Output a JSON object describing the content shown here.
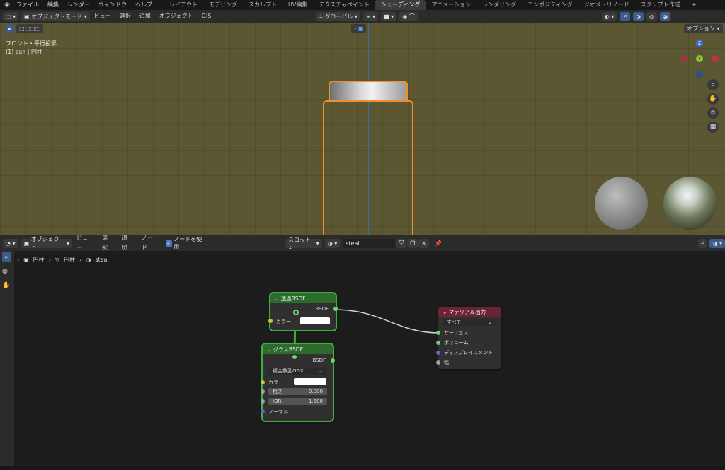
{
  "topbar": {
    "menus": [
      "ファイル",
      "編集",
      "レンダー",
      "ウィンドウ",
      "ヘルプ"
    ],
    "tabs": [
      "レイアウト",
      "モデリング",
      "スカルプト",
      "UV編集",
      "テクスチャペイント",
      "シェーディング",
      "アニメーション",
      "レンダリング",
      "コンポジティング",
      "ジオメトリノード",
      "スクリプト作成",
      "+"
    ]
  },
  "viewport": {
    "mode": "オブジェクトモード",
    "menus": [
      "ビュー",
      "選択",
      "追加",
      "オブジェクト",
      "GIS"
    ],
    "orientation": "グローバル",
    "options": "オプション",
    "view_label": "フロント・平行投影",
    "object_label": "(1) can | 円柱",
    "gizmo": {
      "z": "Z",
      "y": "Y"
    }
  },
  "node_header": {
    "mode": "オブジェクト",
    "menus": [
      "ビュー",
      "選択",
      "追加",
      "ノード"
    ],
    "use_nodes": "ノードを使用",
    "slot": "スロット1",
    "material": "steal"
  },
  "breadcrumb": {
    "obj": "円柱",
    "mesh": "円柱",
    "mat": "steal"
  },
  "nodes": {
    "transparent": {
      "title": "透過BSDF",
      "out": "BSDF",
      "color": "カラー"
    },
    "glass": {
      "title": "グラスBSDF",
      "out": "BSDF",
      "dist": "複合散乱GGX",
      "color": "カラー",
      "rough_label": "粗さ",
      "rough": "0.000",
      "ior_label": "IOR",
      "ior": "1.500",
      "normal": "ノーマル"
    },
    "output": {
      "title": "マテリアル出力",
      "target": "すべて",
      "surface": "サーフェス",
      "volume": "ボリューム",
      "disp": "ディスプレイスメント",
      "width": "幅"
    }
  },
  "colors": {
    "accent": "#3fb03f",
    "outline": "#f0902a",
    "output_header": "#6b2433",
    "shader_header": "#2c6b2c"
  }
}
